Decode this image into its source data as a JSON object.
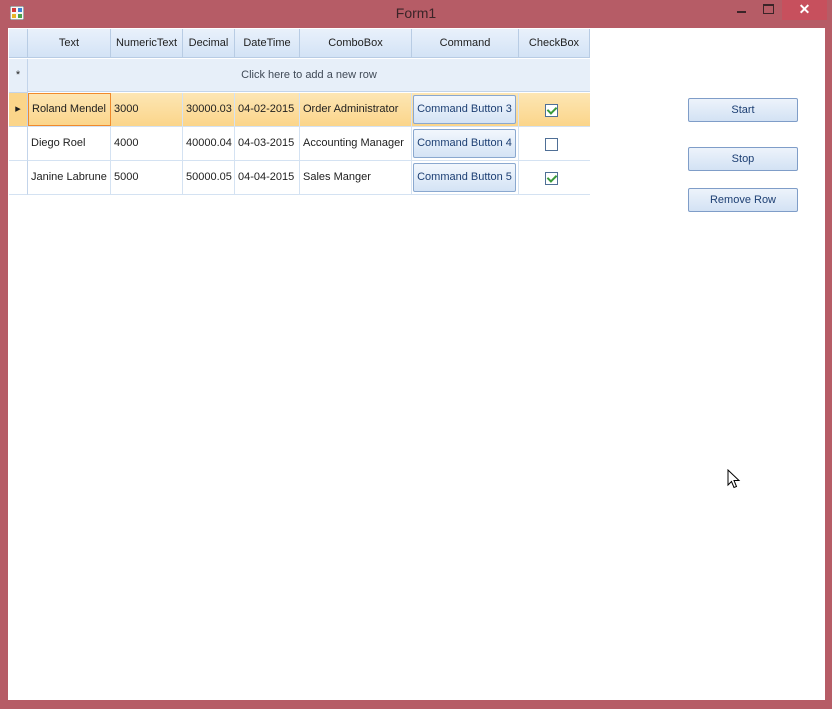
{
  "window": {
    "title": "Form1",
    "close_glyph": "✕"
  },
  "grid": {
    "columns": [
      "Text",
      "NumericText",
      "Decimal",
      "DateTime",
      "ComboBox",
      "Command",
      "CheckBox"
    ],
    "new_row_text": "Click here to add a new row",
    "new_row_marker": "*",
    "current_row_marker": "▸",
    "rows": [
      {
        "text": "Roland Mendel",
        "numeric": "3000",
        "decimal": "30000.03",
        "date": "04-02-2015",
        "combo": "Order Administrator",
        "command": "Command Button 3",
        "checked": true
      },
      {
        "text": "Diego Roel",
        "numeric": "4000",
        "decimal": "40000.04",
        "date": "04-03-2015",
        "combo": "Accounting Manager",
        "command": "Command Button 4",
        "checked": false
      },
      {
        "text": "Janine Labrune",
        "numeric": "5000",
        "decimal": "50000.05",
        "date": "04-04-2015",
        "combo": "Sales Manger",
        "command": "Command Button 5",
        "checked": true
      }
    ]
  },
  "buttons": {
    "start": "Start",
    "stop": "Stop",
    "remove_row": "Remove Row"
  },
  "colors": {
    "window_frame": "#b65c66",
    "selected_row": "#fbd58a",
    "current_cell_border": "#f08a2c",
    "header": "#d3e3f6"
  }
}
